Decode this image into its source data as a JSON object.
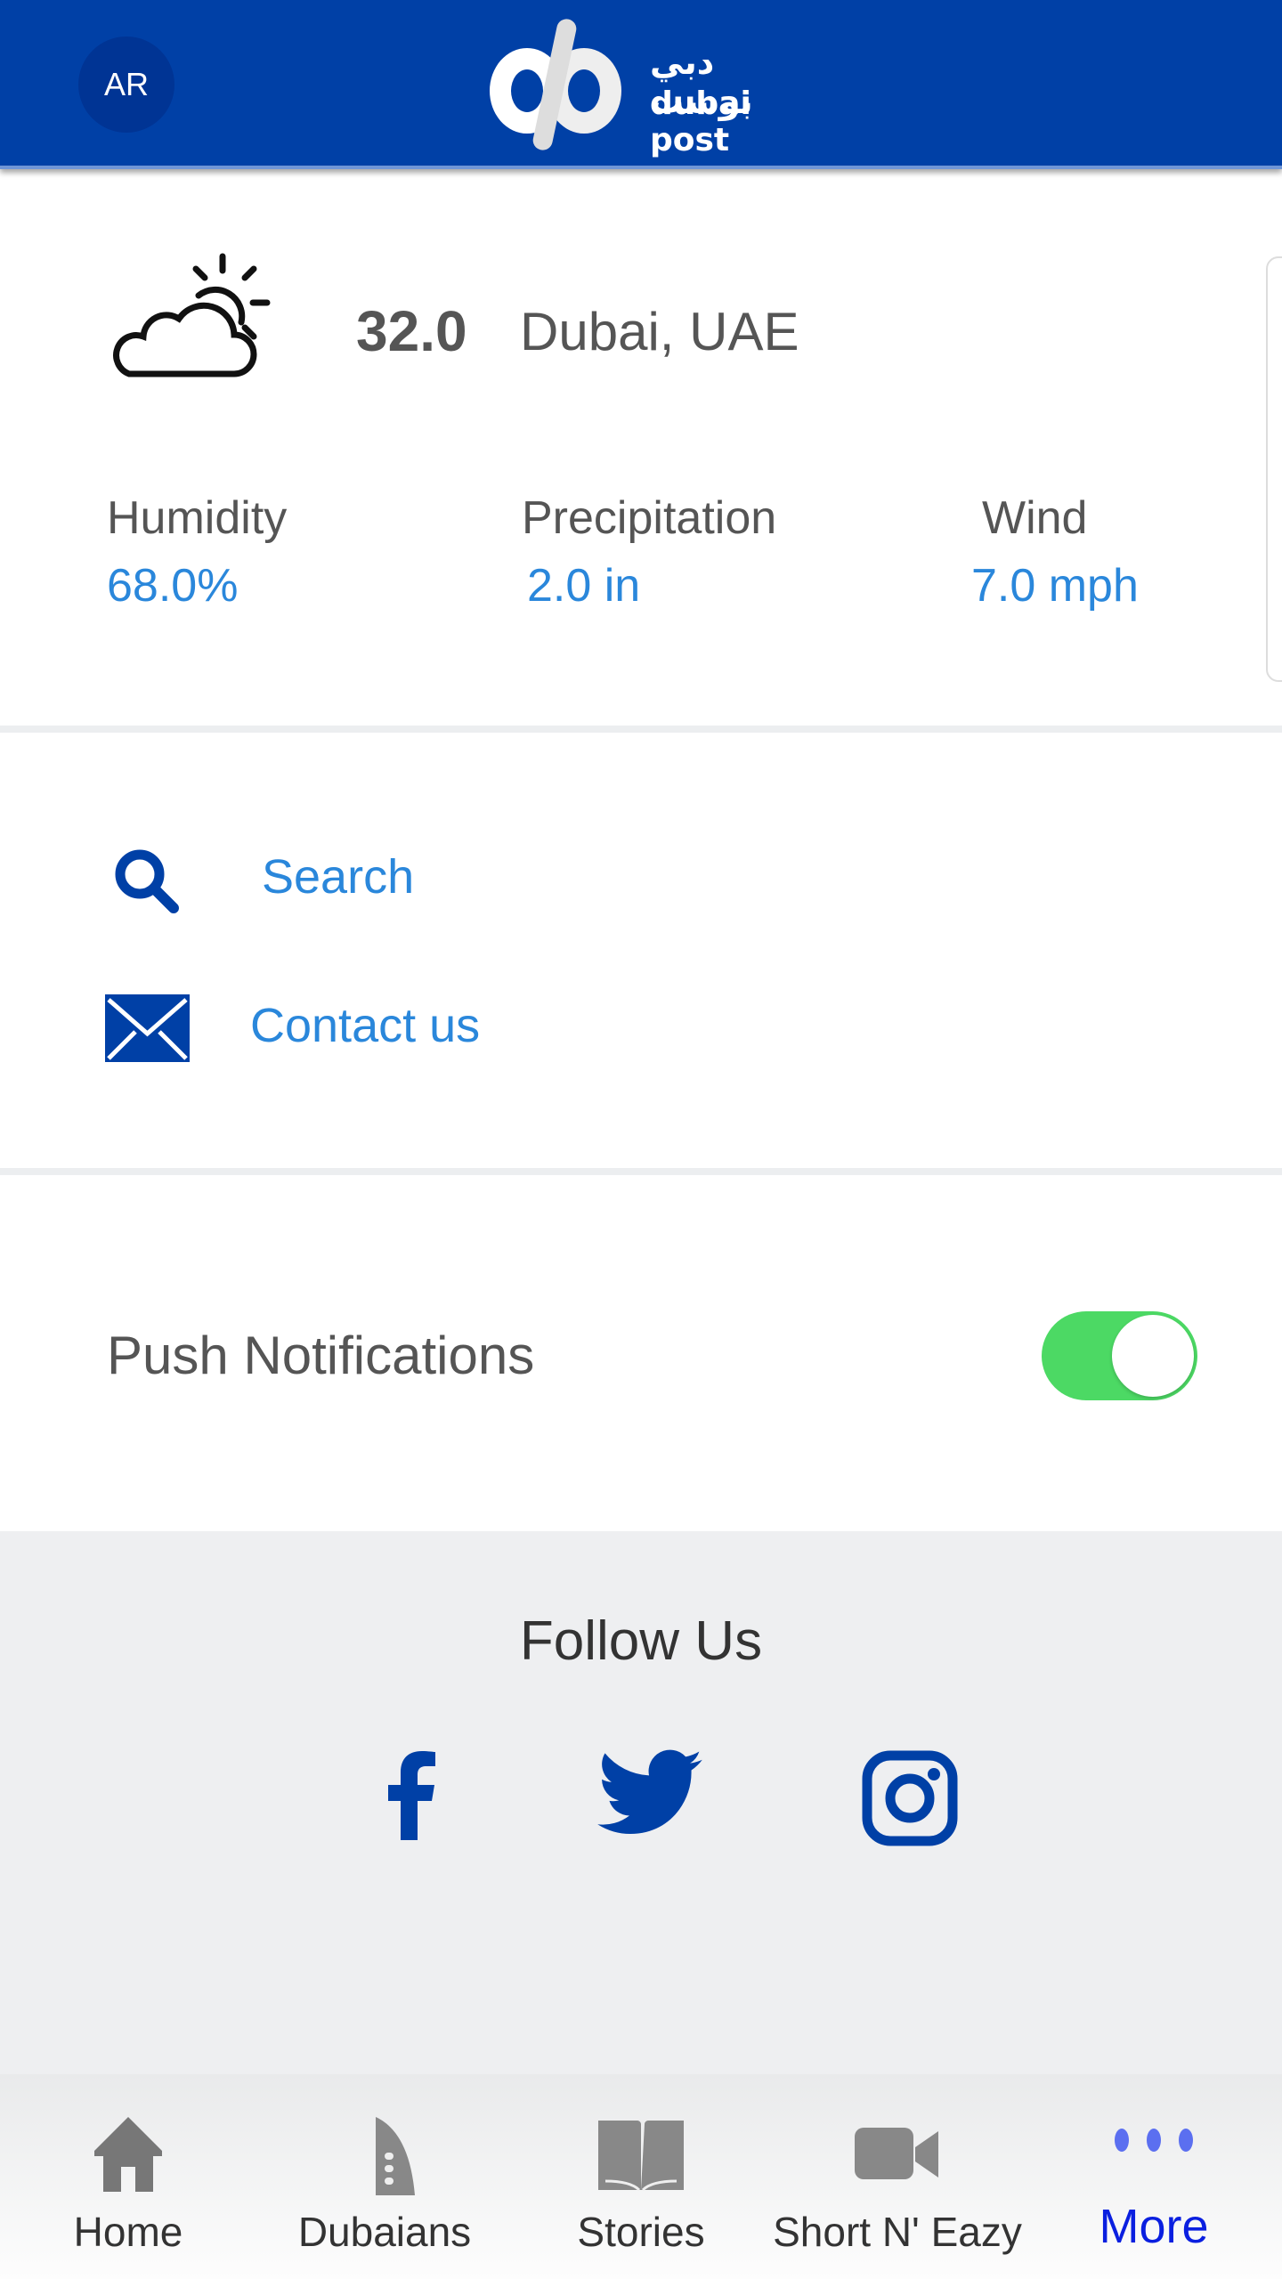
{
  "header": {
    "lang_button": "AR",
    "logo_text_ar": "دبي بوست",
    "logo_text_en": "dubai post",
    "color": "#0040a6"
  },
  "weather": {
    "icon": "partly-cloudy-icon",
    "temperature": "32.0",
    "location": "Dubai, UAE",
    "stats": [
      {
        "label": "Humidity",
        "value": "68.0%"
      },
      {
        "label": "Precipitation",
        "value": "2.0 in"
      },
      {
        "label": "Wind",
        "value": "7.0 mph"
      }
    ]
  },
  "links": [
    {
      "icon": "search-icon",
      "label": "Search"
    },
    {
      "icon": "mail-icon",
      "label": "Contact us"
    }
  ],
  "settings": {
    "push_label": "Push Notifications",
    "push_enabled": true,
    "toggle_color": "#4cd964"
  },
  "follow": {
    "title": "Follow Us",
    "social": [
      "facebook-icon",
      "twitter-icon",
      "instagram-icon"
    ],
    "color": "#0040a6"
  },
  "tabs": [
    {
      "label": "Home",
      "icon": "home-icon"
    },
    {
      "label": "Dubaians",
      "icon": "burj-al-arab-icon"
    },
    {
      "label": "Stories",
      "icon": "book-icon"
    },
    {
      "label": "Short N' Eazy",
      "icon": "video-camera-icon"
    },
    {
      "label": "More",
      "icon": "more-dots-icon",
      "active": true
    }
  ],
  "active_tab_color": "#0a1fe0"
}
